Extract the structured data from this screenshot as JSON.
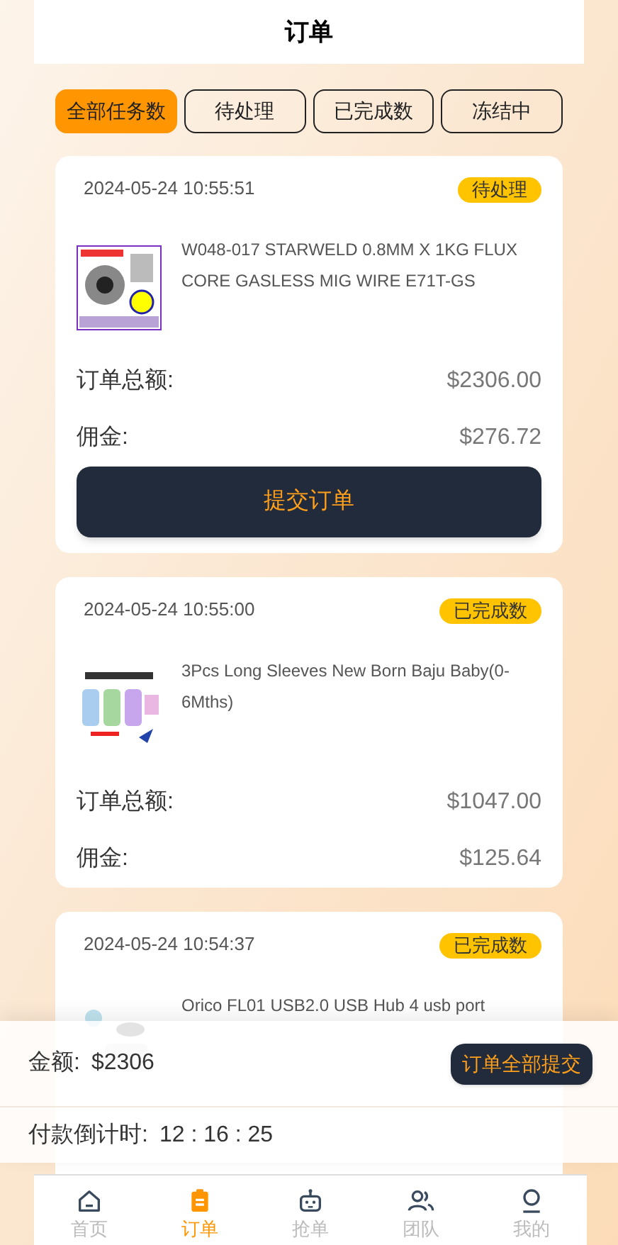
{
  "header": {
    "title": "订单"
  },
  "tabs": [
    {
      "label": "全部任务数",
      "selected": true
    },
    {
      "label": "待处理",
      "selected": false
    },
    {
      "label": "已完成数",
      "selected": false
    },
    {
      "label": "冻结中",
      "selected": false
    }
  ],
  "orders": [
    {
      "time": "2024-05-24 10:55:51",
      "status": {
        "label": "待处理"
      },
      "product": {
        "title": "W048-017 STARWELD 0.8MM X 1KG FLUX CORE GASLESS MIG WIRE E71T-GS"
      },
      "total_label": "订单总额:",
      "total": "$2306.00",
      "commission_label": "佣金:",
      "commission": "$276.72",
      "submit_button": "提交订单"
    },
    {
      "time": "2024-05-24 10:55:00",
      "status": {
        "label": "已完成数"
      },
      "product": {
        "title": "3Pcs Long Sleeves New Born Baju Baby(0-6Mths)"
      },
      "total_label": "订单总额:",
      "total": "$1047.00",
      "commission_label": "佣金:",
      "commission": "$125.64"
    },
    {
      "time": "2024-05-24 10:54:37",
      "status": {
        "label": "已完成数"
      },
      "product": {
        "title": "Orico FL01 USB2.0 USB Hub 4 usb port"
      }
    }
  ],
  "summary": {
    "amount_label": "金额:",
    "amount": "$2306",
    "submit_all_button": "订单全部提交",
    "countdown_label": "付款倒计时:",
    "countdown": "12 : 16 : 25"
  },
  "bottom_nav": [
    {
      "label": "首页",
      "selected": false
    },
    {
      "label": "订单",
      "selected": true
    },
    {
      "label": "抢单",
      "selected": false
    },
    {
      "label": "团队",
      "selected": false
    },
    {
      "label": "我的",
      "selected": false
    }
  ]
}
